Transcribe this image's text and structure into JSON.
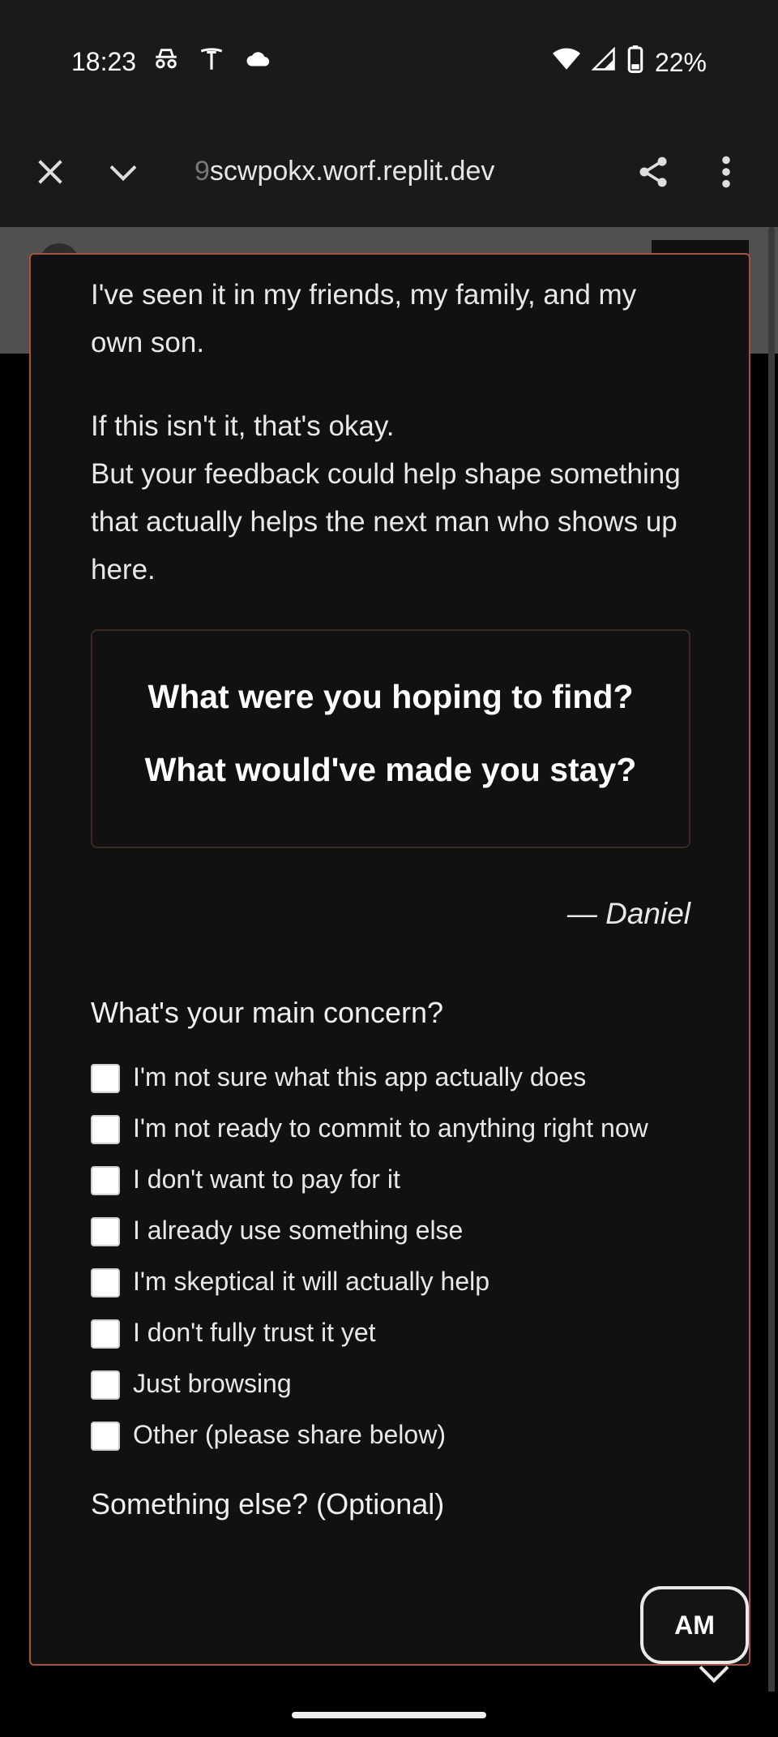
{
  "status": {
    "time": "18:23",
    "battery": "22%",
    "left_icons": [
      "incognito-icon",
      "tesla-icon",
      "cloud-icon"
    ],
    "right_icons": [
      "wifi-icon",
      "signal-icon",
      "battery-icon"
    ]
  },
  "browser": {
    "url_prefix": "9",
    "url": "scwpokx.worf.replit.dev"
  },
  "modal": {
    "para1": "I've seen it in my friends, my family, and my own son.",
    "para2_line1": "If this isn't it, that's okay.",
    "para2_line2": "But your feedback could help shape something that actually helps the next man who shows up here.",
    "question1": "What were you hoping to find?",
    "question2": "What would've made you stay?",
    "signature": "— Daniel",
    "concern_title": "What's your main concern?",
    "options": [
      "I'm not sure what this app actually does",
      "I'm not ready to commit to anything right now",
      "I don't want to pay for it",
      "I already use something else",
      "I'm skeptical it will actually help",
      "I don't fully trust it yet",
      "Just browsing",
      "Other (please share below)"
    ],
    "optional_title": "Something else? (Optional)"
  },
  "badge": {
    "label": "AM"
  },
  "colors": {
    "modal_border": "#a4543b",
    "modal_bg": "#111111",
    "chrome_bg": "#1b1a19"
  }
}
